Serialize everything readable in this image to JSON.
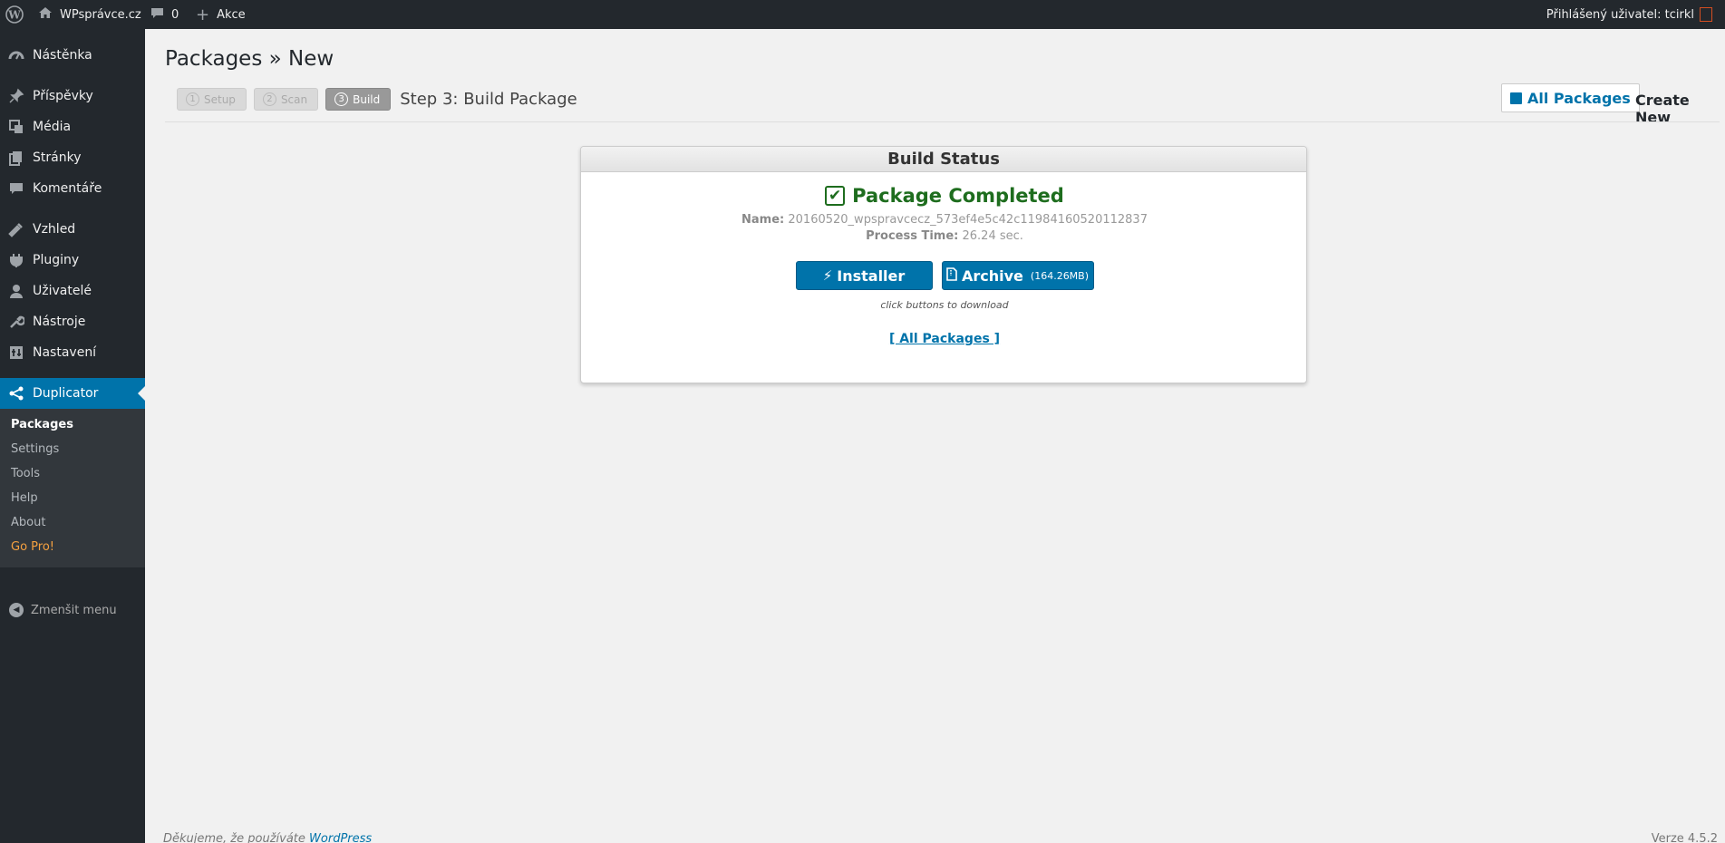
{
  "adminbar": {
    "site_name": "WPsprávce.cz",
    "comments_count": "0",
    "new_label": "Akce",
    "user_label": "Přihlášený uživatel: tcirkl"
  },
  "sidebar": {
    "items": [
      {
        "label": "Nástěnka",
        "icon": "dashboard-icon"
      },
      {
        "label": "Příspěvky",
        "icon": "pin-icon"
      },
      {
        "label": "Média",
        "icon": "media-icon"
      },
      {
        "label": "Stránky",
        "icon": "pages-icon"
      },
      {
        "label": "Komentáře",
        "icon": "comments-icon"
      },
      {
        "label": "Vzhled",
        "icon": "appearance-icon"
      },
      {
        "label": "Pluginy",
        "icon": "plugins-icon"
      },
      {
        "label": "Uživatelé",
        "icon": "users-icon"
      },
      {
        "label": "Nástroje",
        "icon": "tools-icon"
      },
      {
        "label": "Nastavení",
        "icon": "settings-icon"
      },
      {
        "label": "Duplicator",
        "icon": "share-icon"
      }
    ],
    "submenu": [
      "Packages",
      "Settings",
      "Tools",
      "Help",
      "About",
      "Go Pro!"
    ],
    "collapse_label": "Zmenšit menu"
  },
  "page": {
    "title": "Packages » New",
    "steps": [
      {
        "num": "1",
        "label": "Setup"
      },
      {
        "num": "2",
        "label": "Scan"
      },
      {
        "num": "3",
        "label": "Build"
      }
    ],
    "step_title": "Step 3: Build Package",
    "all_packages_button": "All Packages",
    "create_new": "Create New"
  },
  "build": {
    "header": "Build Status",
    "status": "Package Completed",
    "name_label": "Name:",
    "name_value": "20160520_wpspravcecz_573ef4e5c42c11984160520112837",
    "time_label": "Process Time:",
    "time_value": "26.24 sec.",
    "installer_label": "Installer",
    "archive_label": "Archive",
    "archive_size": "(164.26MB)",
    "hint": "click buttons to download",
    "all_link": "[ All Packages ]"
  },
  "footer": {
    "thanks": "Děkujeme, že používáte",
    "wp_link": "WordPress",
    "version": "Verze 4.5.2"
  },
  "colors": {
    "accent": "#0073aa",
    "sidebar_bg": "#23282d",
    "success": "#1e6d1e",
    "gopro": "#f6a140"
  }
}
